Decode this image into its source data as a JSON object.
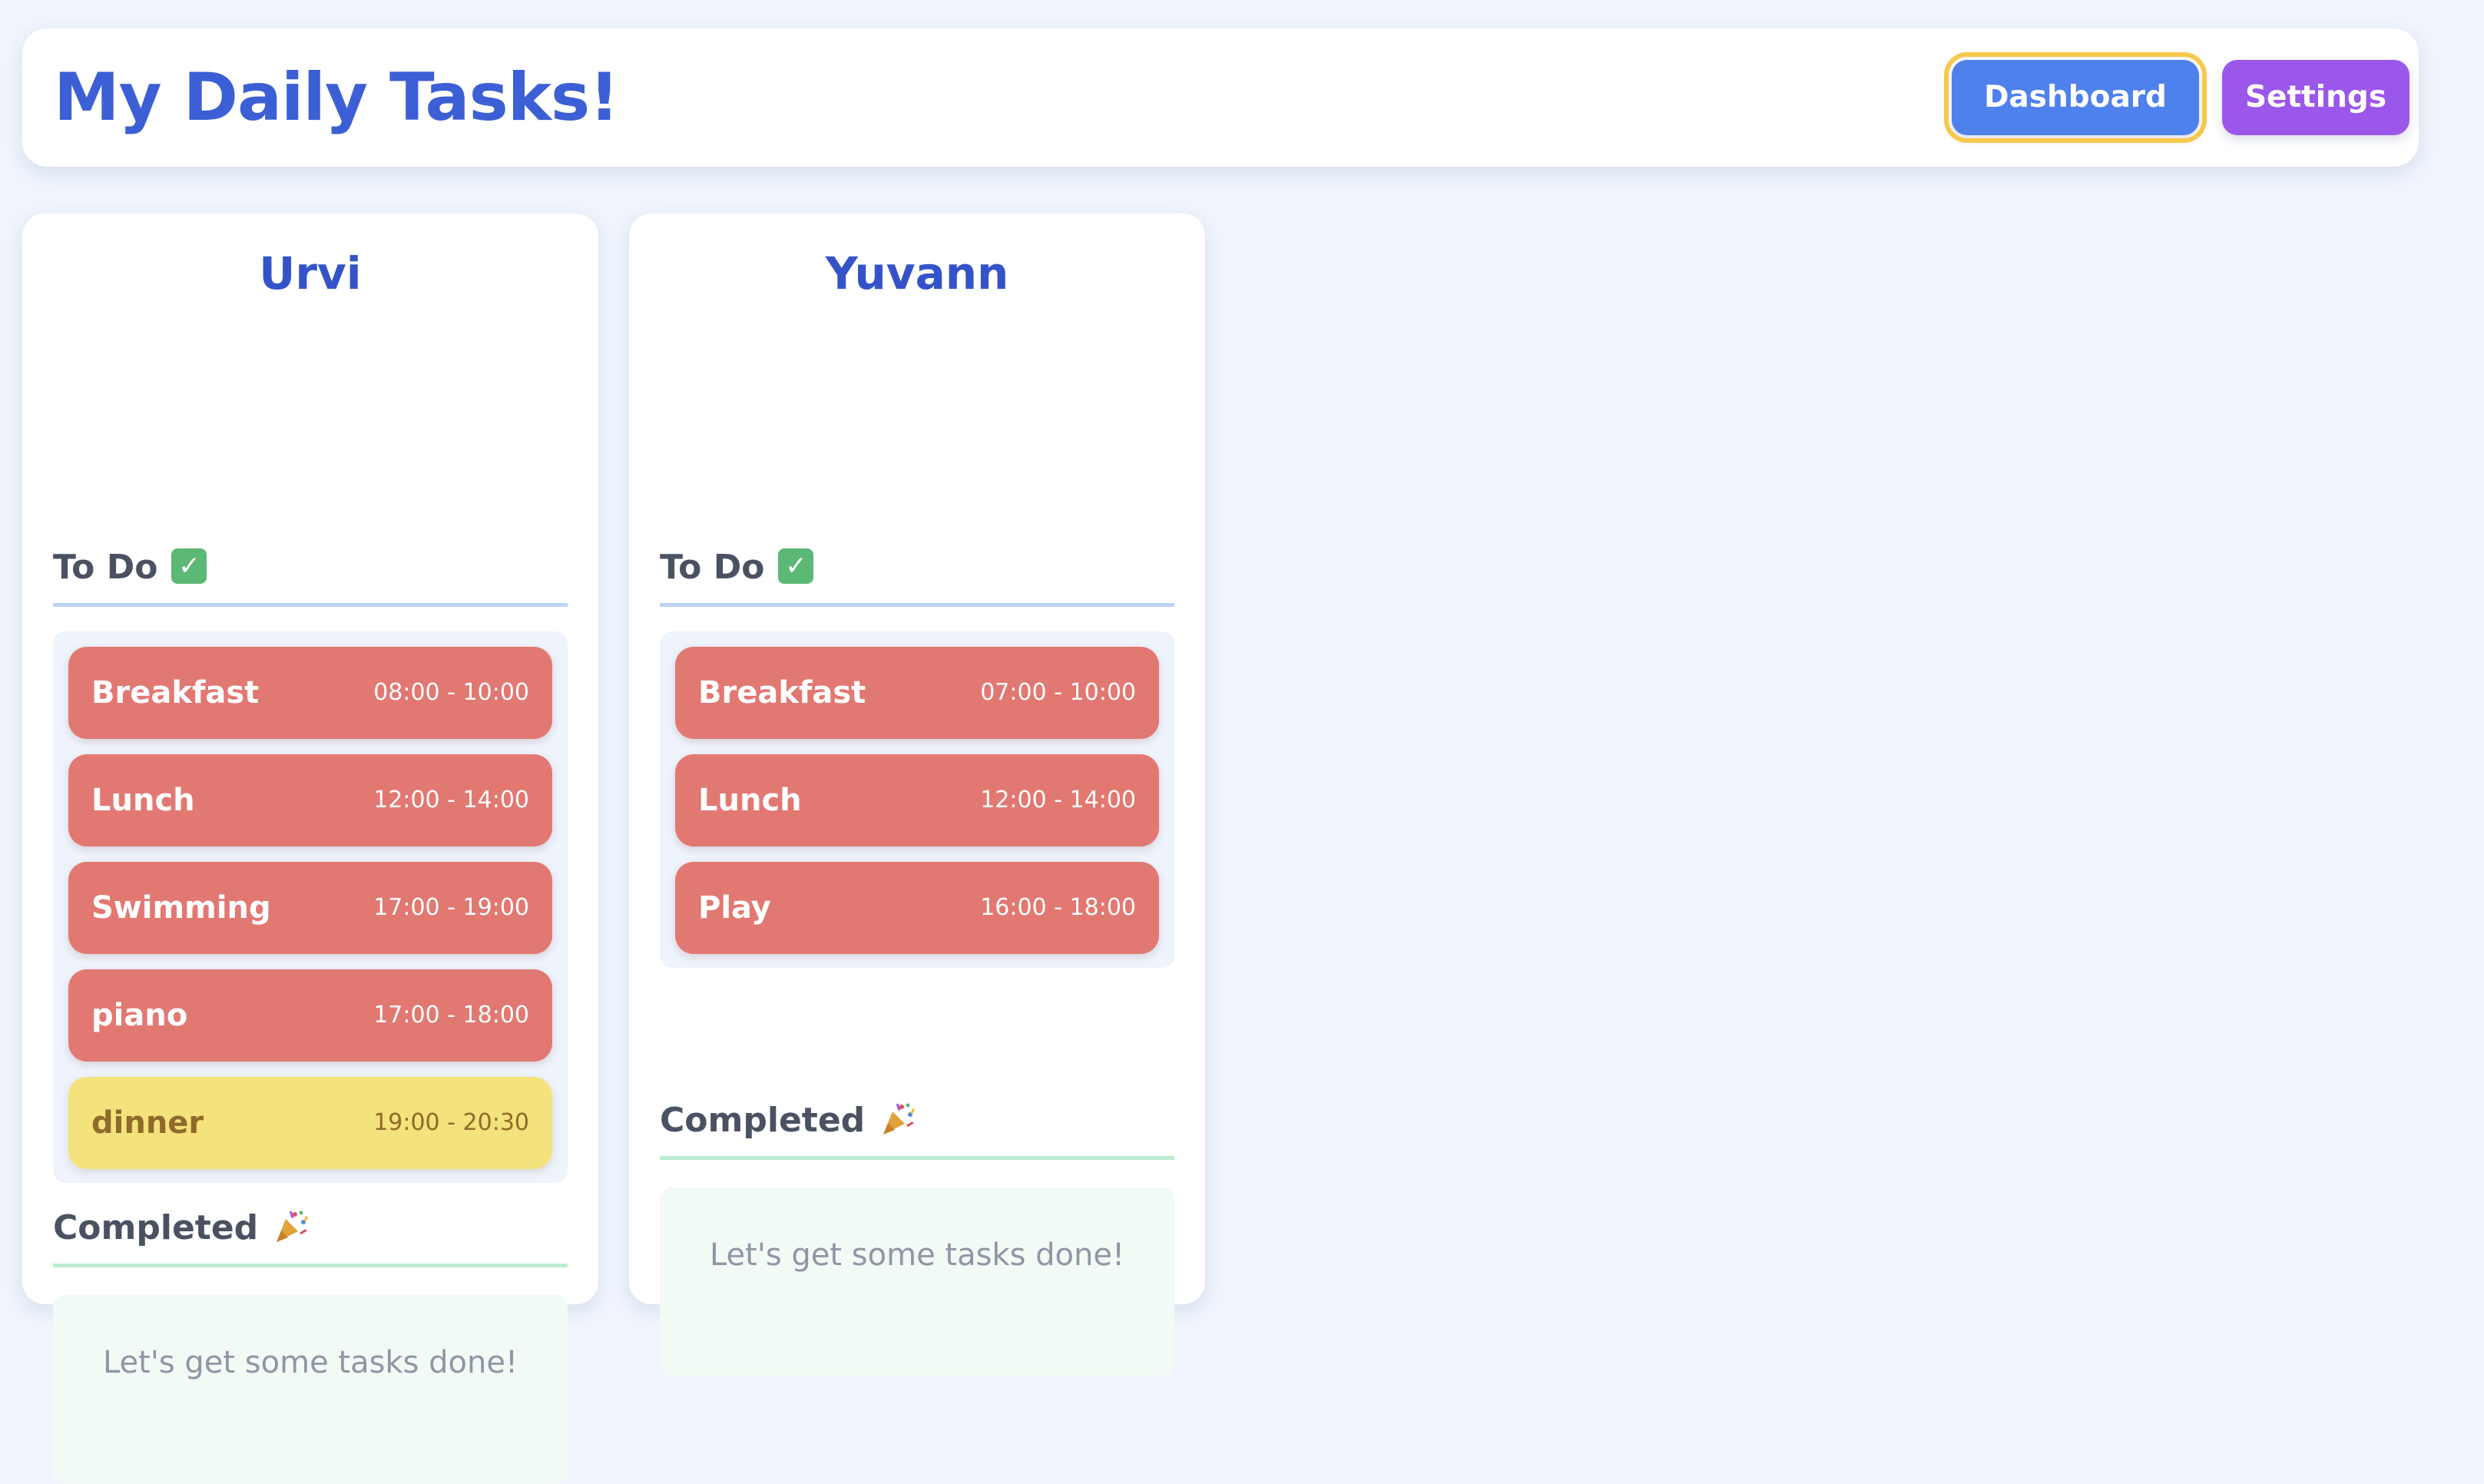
{
  "header": {
    "title": "My Daily Tasks!",
    "dashboard_label": "Dashboard",
    "settings_label": "Settings"
  },
  "people": [
    {
      "name": "Urvi",
      "todo_label": "To Do",
      "completed_label": "Completed",
      "empty_message": "Let's get some tasks done!",
      "tasks": [
        {
          "name": "Breakfast",
          "time": "08:00 - 10:00",
          "color": "#e27872"
        },
        {
          "name": "Lunch",
          "time": "12:00 - 14:00",
          "color": "#e27872"
        },
        {
          "name": "Swimming",
          "time": "17:00 - 19:00",
          "color": "#e27872"
        },
        {
          "name": "piano",
          "time": "17:00 - 18:00",
          "color": "#e27872"
        },
        {
          "name": "dinner",
          "time": "19:00 - 20:30",
          "color": "#f4e27c"
        }
      ]
    },
    {
      "name": "Yuvann",
      "todo_label": "To Do",
      "completed_label": "Completed",
      "empty_message": "Let's get some tasks done!",
      "tasks": [
        {
          "name": "Breakfast",
          "time": "07:00 - 10:00",
          "color": "#e27872"
        },
        {
          "name": "Lunch",
          "time": "12:00 - 14:00",
          "color": "#e27872"
        },
        {
          "name": "Play",
          "time": "16:00 - 18:00",
          "color": "#e27872"
        }
      ]
    }
  ],
  "icons": {
    "todo": "check-mark-icon",
    "completed": "party-popper-icon"
  },
  "colors": {
    "background": "#eff4fd",
    "title": "#3c5fd6",
    "dashboard_button": "#4f81ec",
    "dashboard_focus_ring": "#f7c84a",
    "settings_button": "#9b57ea",
    "task_pending": "#e27872",
    "task_upcoming": "#f4e27c"
  }
}
